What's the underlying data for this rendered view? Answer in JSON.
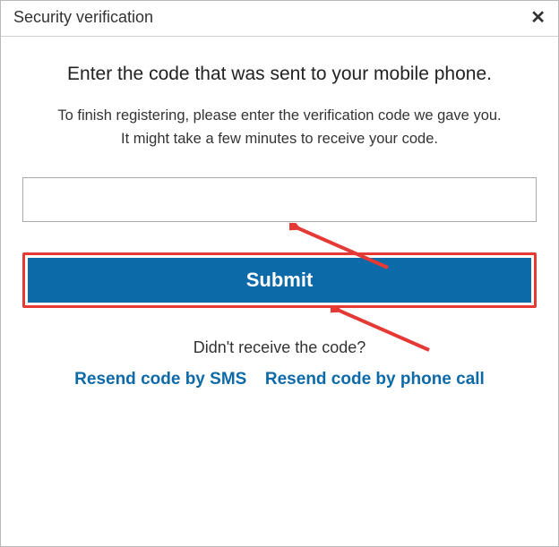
{
  "titlebar": {
    "title": "Security verification"
  },
  "heading": "Enter the code that was sent to your mobile phone.",
  "description_line1": "To finish registering, please enter the verification code we gave you.",
  "description_line2": "It might take a few minutes to receive your code.",
  "code_value": "",
  "code_placeholder": "",
  "submit_label": "Submit",
  "no_receive": "Didn't receive the code?",
  "resend_sms": "Resend code by SMS",
  "resend_call": "Resend code by phone call"
}
